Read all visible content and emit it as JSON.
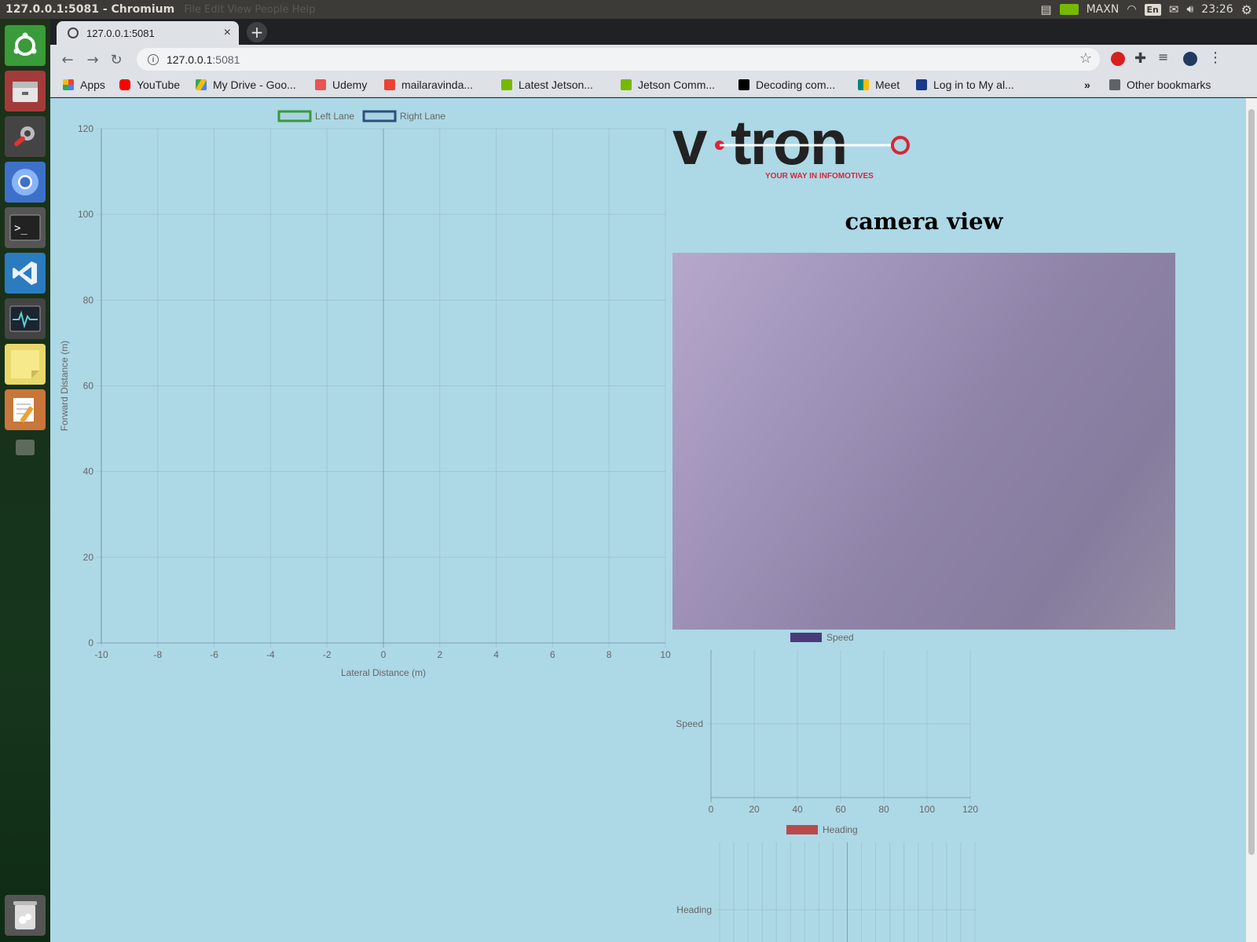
{
  "os": {
    "window_title": "127.0.0.1:5081 - Chromium",
    "ghost_menu": "File  Edit  View  People  Help",
    "power_mode": "MAXN",
    "keyboard_layout": "En",
    "clock": "23:26"
  },
  "browser": {
    "tab_title": "127.0.0.1:5081",
    "url_host": "127.0.0.1",
    "url_port": ":5081",
    "bookmarks": [
      {
        "label": "Apps",
        "color": "#4285f4"
      },
      {
        "label": "YouTube",
        "color": "#ff0000"
      },
      {
        "label": "My Drive - Goo...",
        "color": "#fbbc04"
      },
      {
        "label": "Udemy",
        "color": "#ec5252"
      },
      {
        "label": "mailaravinda...",
        "color": "#ea4335"
      },
      {
        "label": "Latest Jetson...",
        "color": "#76b900"
      },
      {
        "label": "Jetson Comm...",
        "color": "#76b900"
      },
      {
        "label": "Decoding com...",
        "color": "#000000"
      },
      {
        "label": "Meet",
        "color": "#00897b"
      },
      {
        "label": "Log in to My al...",
        "color": "#1a3a8a"
      }
    ],
    "overflow": "»",
    "other_bookmarks": "Other bookmarks"
  },
  "page": {
    "logo_text": "v·tron",
    "logo_tagline": "YOUR WAY IN INFOMOTIVES",
    "camera_title": "camera view"
  },
  "chart_data": [
    {
      "type": "line",
      "series": [
        {
          "name": "Left Lane",
          "color": "#3a9a3a",
          "values": []
        },
        {
          "name": "Right Lane",
          "color": "#2c4f7c",
          "values": []
        }
      ],
      "xlabel": "Lateral Distance (m)",
      "ylabel": "Forward Distance (m)",
      "xlim": [
        -10,
        10
      ],
      "ylim": [
        0,
        120
      ],
      "xticks": [
        -10,
        -8,
        -6,
        -4,
        -2,
        0,
        2,
        4,
        6,
        8,
        10
      ],
      "yticks": [
        0,
        20,
        40,
        60,
        80,
        100,
        120
      ],
      "grid": true,
      "legend": "top"
    },
    {
      "type": "bar",
      "orientation": "horizontal",
      "categories": [
        "Speed"
      ],
      "series": [
        {
          "name": "Speed",
          "color": "#4b3a7a",
          "values": []
        }
      ],
      "xlim": [
        0,
        120
      ],
      "xticks": [
        0,
        20,
        40,
        60,
        80,
        100,
        120
      ],
      "grid": true,
      "legend": "top"
    },
    {
      "type": "bar",
      "orientation": "horizontal",
      "categories": [
        "Heading"
      ],
      "series": [
        {
          "name": "Heading",
          "color": "#b94a48",
          "values": []
        }
      ],
      "grid": true,
      "legend": "top"
    }
  ]
}
